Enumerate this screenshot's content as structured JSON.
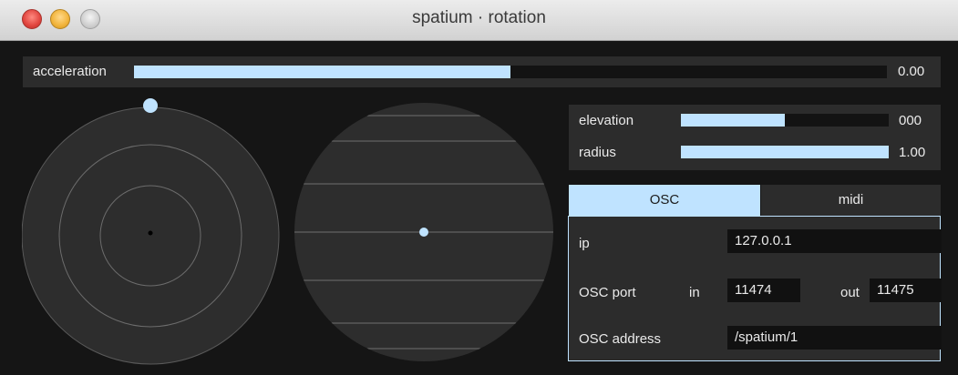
{
  "window": {
    "title": "spatium · rotation",
    "controls": [
      "close",
      "minimize",
      "zoom"
    ]
  },
  "acceleration": {
    "label": "acceleration",
    "value_text": "0.00",
    "level": 0.5
  },
  "params": [
    {
      "label": "elevation",
      "value_text": "000",
      "level": 0.5
    },
    {
      "label": "radius",
      "value_text": "1.00",
      "level": 1.0
    }
  ],
  "tabs": [
    {
      "label": "OSC",
      "active": true
    },
    {
      "label": "midi",
      "active": false
    }
  ],
  "osc": {
    "ip_label": "ip",
    "ip_value": "127.0.0.1",
    "port_label": "OSC port",
    "in_label": "in",
    "in_value": "11474",
    "out_label": "out",
    "out_value": "11475",
    "address_label": "OSC address",
    "address_value": "/spatium/1"
  },
  "colors": {
    "accent": "#bfe3ff",
    "panel": "#2c2c2c",
    "background": "#151515",
    "track": "#131313"
  }
}
